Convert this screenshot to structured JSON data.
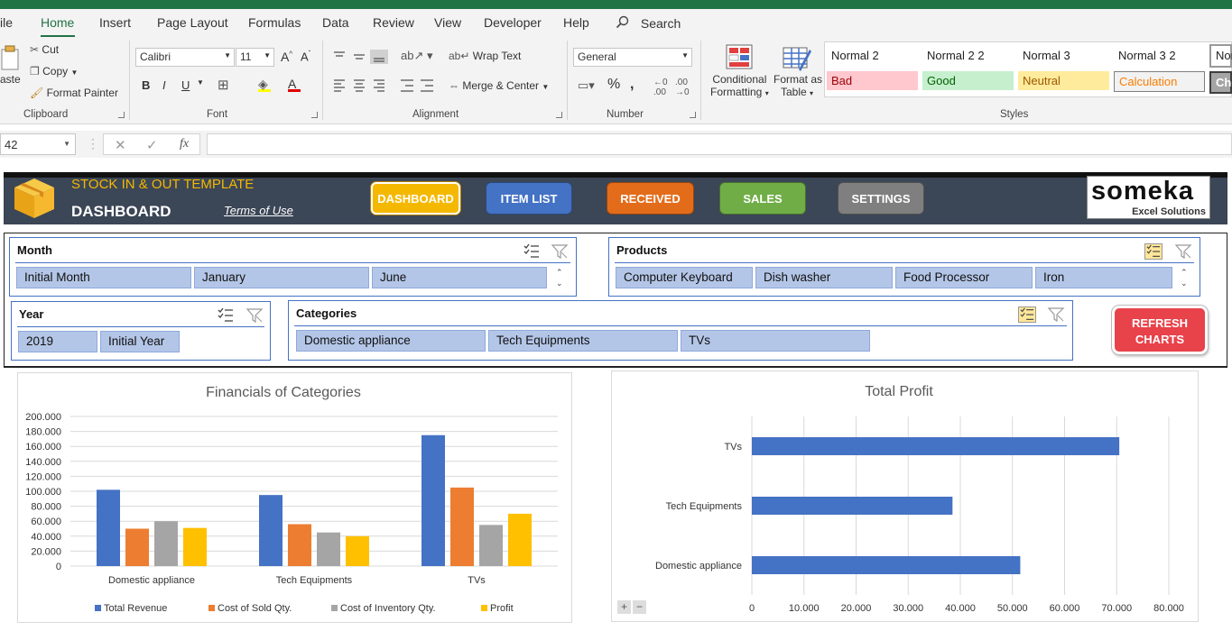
{
  "ribbon_tabs": [
    "ile",
    "Home",
    "Insert",
    "Page Layout",
    "Formulas",
    "Data",
    "Review",
    "View",
    "Developer",
    "Help"
  ],
  "search_label": "Search",
  "clipboard": {
    "paste": "aste",
    "cut": "Cut",
    "copy": "Copy",
    "format_painter": "Format Painter",
    "group": "Clipboard"
  },
  "font": {
    "name": "Calibri",
    "size": "11",
    "group": "Font"
  },
  "alignment": {
    "wrap_text": "Wrap Text",
    "merge_center": "Merge & Center",
    "group": "Alignment"
  },
  "number": {
    "format": "General",
    "group": "Number"
  },
  "styles_group": {
    "conditional_formatting_1": "Conditional",
    "conditional_formatting_2": "Formatting",
    "format_as_table_1": "Format as",
    "format_as_table_2": "Table",
    "group": "Styles",
    "cells": [
      {
        "label": "Normal 2",
        "bg": "#ffffff",
        "color": "#111111"
      },
      {
        "label": "Normal 2 2",
        "bg": "#ffffff",
        "color": "#111111"
      },
      {
        "label": "Normal 3",
        "bg": "#ffffff",
        "color": "#111111"
      },
      {
        "label": "Normal 3 2",
        "bg": "#ffffff",
        "color": "#111111"
      },
      {
        "label": "Nor",
        "bg": "#ffffff",
        "color": "#111111"
      },
      {
        "label": "Bad",
        "bg": "#ffc7ce",
        "color": "#9c0006"
      },
      {
        "label": "Good",
        "bg": "#c6efce",
        "color": "#006100"
      },
      {
        "label": "Neutral",
        "bg": "#ffeb9c",
        "color": "#9c5700"
      },
      {
        "label": "Calculation",
        "bg": "#f2f2f2",
        "color": "#fa7d00"
      },
      {
        "label": "Che",
        "bg": "#a5a5a5",
        "color": "#ffffff"
      }
    ]
  },
  "name_box": "42",
  "formula_fx": "fx",
  "dashboard": {
    "template_title": "STOCK IN & OUT TEMPLATE",
    "page_title": "DASHBOARD",
    "terms_link": "Terms of Use",
    "logo_text": "someka",
    "logo_sub": "Excel Solutions",
    "nav": [
      {
        "label": "DASHBOARD",
        "bg": "#f5b800"
      },
      {
        "label": "ITEM LIST",
        "bg": "#4472c4"
      },
      {
        "label": "RECEIVED",
        "bg": "#e36c1b"
      },
      {
        "label": "SALES",
        "bg": "#70ad47"
      },
      {
        "label": "SETTINGS",
        "bg": "#7f7f7f"
      }
    ],
    "refresh_1": "REFRESH",
    "refresh_2": "CHARTS"
  },
  "slicers": {
    "month": {
      "title": "Month",
      "items": [
        "Initial Month",
        "January",
        "June"
      ]
    },
    "products": {
      "title": "Products",
      "items": [
        "Computer Keyboard",
        "Dish washer",
        "Food Processor",
        "Iron"
      ]
    },
    "year": {
      "title": "Year",
      "items": [
        "2019",
        "Initial Year"
      ]
    },
    "categories": {
      "title": "Categories",
      "items": [
        "Domestic appliance",
        "Tech Equipments",
        "TVs"
      ]
    }
  },
  "zoom_buttons": [
    "+",
    "−"
  ],
  "chart_data": [
    {
      "type": "bar",
      "title": "Financials of Categories",
      "categories": [
        "Domestic appliance",
        "Tech Equipments",
        "TVs"
      ],
      "series": [
        {
          "name": "Total Revenue",
          "color": "#4472c4",
          "values": [
            102000,
            95000,
            175000
          ]
        },
        {
          "name": "Cost of Sold Qty.",
          "color": "#ed7d31",
          "values": [
            50000,
            56000,
            105000
          ]
        },
        {
          "name": "Cost of Inventory Qty.",
          "color": "#a5a5a5",
          "values": [
            60000,
            45000,
            55000
          ]
        },
        {
          "name": "Profit",
          "color": "#ffc000",
          "values": [
            51000,
            40000,
            70000
          ]
        }
      ],
      "ylim": [
        0,
        200000
      ],
      "yticks": [
        "0",
        "20.000",
        "40.000",
        "60.000",
        "80.000",
        "100.000",
        "120.000",
        "140.000",
        "160.000",
        "180.000",
        "200.000"
      ],
      "legend": "bottom",
      "grid": true
    },
    {
      "type": "bar",
      "orientation": "horizontal",
      "title": "Total Profit",
      "categories": [
        "TVs",
        "Tech Equipments",
        "Domestic appliance"
      ],
      "values": [
        70500,
        38500,
        51500
      ],
      "color": "#4472c4",
      "xlim": [
        0,
        80000
      ],
      "xticks": [
        "0",
        "10.000",
        "20.000",
        "30.000",
        "40.000",
        "50.000",
        "60.000",
        "70.000",
        "80.000"
      ],
      "grid": true
    }
  ]
}
